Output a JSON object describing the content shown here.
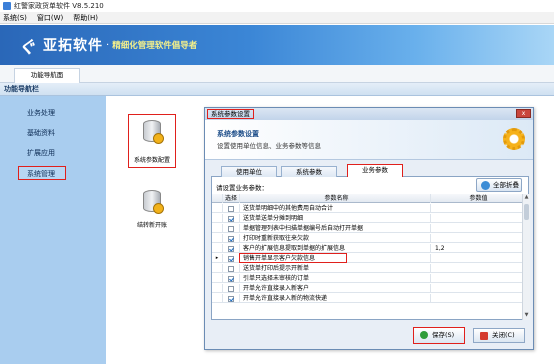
{
  "window": {
    "title": "红警家政货单软件 V8.5.210"
  },
  "menu": [
    {
      "label": "系统(S)"
    },
    {
      "label": "窗口(W)"
    },
    {
      "label": "帮助(H)"
    }
  ],
  "banner": {
    "logo": "ぐ",
    "name": "亚拓软件",
    "sep": "·",
    "tagline": "精细化管理软件倡导者"
  },
  "tabs": {
    "guide": "功能导航面"
  },
  "nav": {
    "header": "功能导航栏",
    "items": [
      {
        "label": "业务处理"
      },
      {
        "label": "基础资料"
      },
      {
        "label": "扩展应用"
      },
      {
        "label": "系统管理"
      }
    ]
  },
  "tools": [
    {
      "label": "系统参数配置"
    },
    {
      "label": "结转新开账"
    }
  ],
  "dialog": {
    "title": "系统参数设置",
    "close": "x",
    "heading": "系统参数设置",
    "subheading": "设置使用单位信息、业务参数等信息",
    "tabs": [
      {
        "label": "使用单位"
      },
      {
        "label": "系统参数"
      },
      {
        "label": "业务参数"
      }
    ],
    "prompt": "请设置业务参数：",
    "collapse_label": "全部折叠",
    "grid": {
      "headers": {
        "select": "选择",
        "name": "参数名称",
        "value": "参数值"
      },
      "rows": [
        {
          "checked": false,
          "name": "送货单明细中的其他费用自动合计",
          "value": ""
        },
        {
          "checked": true,
          "name": "送货单送单分摊到明细",
          "value": ""
        },
        {
          "checked": false,
          "name": "单据管理列表中扫描单据编号后自动打开单据",
          "value": ""
        },
        {
          "checked": true,
          "name": "打印时重新获取往来欠款",
          "value": ""
        },
        {
          "checked": true,
          "name": "客户的扩展信息提取到单据的扩展信息",
          "value": "1,2"
        },
        {
          "checked": true,
          "name": "销售开单显示客户欠款信息",
          "value": ""
        },
        {
          "checked": false,
          "name": "送货单打印后提示开新单",
          "value": ""
        },
        {
          "checked": true,
          "name": "引单只选择未审核的订单",
          "value": ""
        },
        {
          "checked": false,
          "name": "开单允许直接录入新客户",
          "value": ""
        },
        {
          "checked": true,
          "name": "开单允许直接录入新的物流快递",
          "value": ""
        }
      ],
      "current_indicator": "▸"
    },
    "save_label": "保存(S)",
    "close_label": "关闭(C)"
  }
}
